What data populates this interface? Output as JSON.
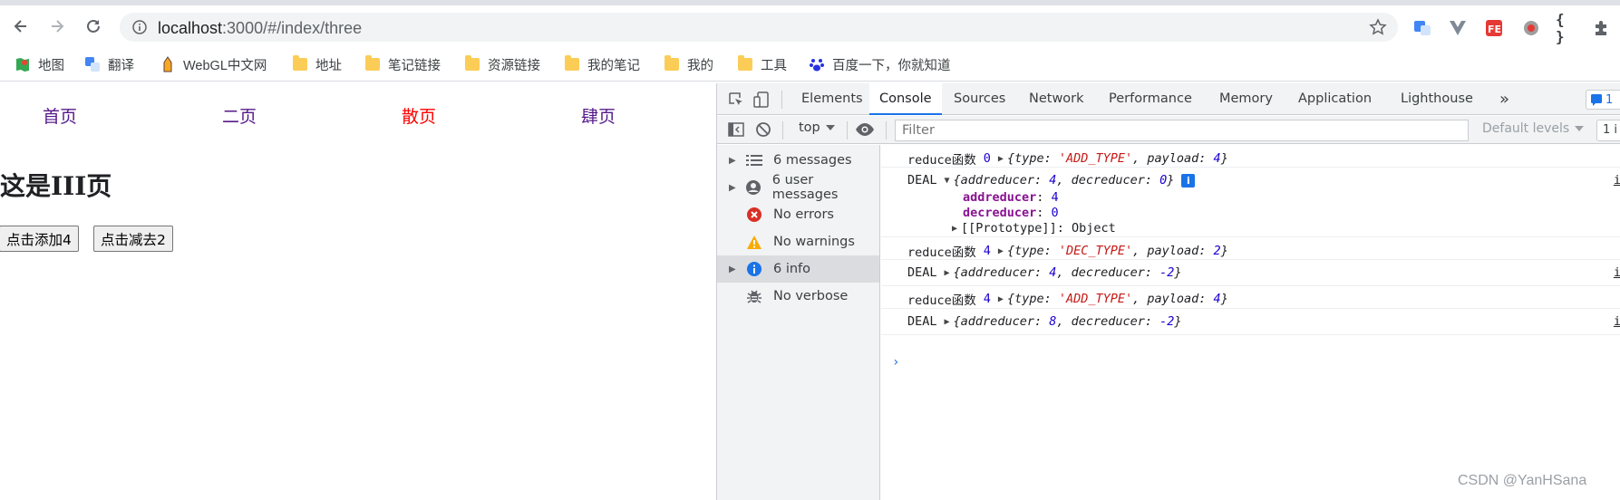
{
  "browser": {
    "url_host": "localhost",
    "url_rest": ":3000/#/index/three",
    "bookmarks": [
      {
        "label": "地图"
      },
      {
        "label": "翻译"
      },
      {
        "label": "WebGL中文网"
      },
      {
        "label": "地址"
      },
      {
        "label": "笔记链接"
      },
      {
        "label": "资源链接"
      },
      {
        "label": "我的笔记"
      },
      {
        "label": "我的"
      },
      {
        "label": "工具"
      },
      {
        "label": "百度一下，你就知道"
      }
    ],
    "ext_braces": "{ }"
  },
  "page": {
    "nav": [
      {
        "label": "首页",
        "color": "#551a8b"
      },
      {
        "label": "二页",
        "color": "#551a8b"
      },
      {
        "label": "散页",
        "color": "#ff0000"
      },
      {
        "label": "肆页",
        "color": "#551a8b"
      }
    ],
    "title": "这是III页",
    "add_button": "点击添加4",
    "sub_button": "点击减去2",
    "watermark": "CSDN @YanHSana"
  },
  "devtools": {
    "tabs": [
      "Elements",
      "Console",
      "Sources",
      "Network",
      "Performance",
      "Memory",
      "Application",
      "Lighthouse"
    ],
    "active_tab": "Console",
    "more_tabs": "»",
    "issues_count": "1",
    "context": "top",
    "filter_placeholder": "Filter",
    "levels": "Default levels",
    "hidden_count": "1 i",
    "sidebar": [
      {
        "label": "6 messages",
        "icon": "list-icon",
        "expandable": true
      },
      {
        "label": "6 user messages",
        "icon": "user-icon",
        "expandable": true
      },
      {
        "label": "No errors",
        "icon": "error-icon",
        "expandable": false
      },
      {
        "label": "No warnings",
        "icon": "warning-icon",
        "expandable": false
      },
      {
        "label": "6 info",
        "icon": "info-icon",
        "expandable": true,
        "selected": true
      },
      {
        "label": "No verbose",
        "icon": "bug-icon",
        "expandable": false
      }
    ],
    "console": {
      "row1": {
        "prefix": "reduce函数",
        "arg": "0",
        "obj_open": "{type: ",
        "type": "'ADD_TYPE'",
        "mid": ", payload: ",
        "payload": "4",
        "close": "}"
      },
      "row2": {
        "prefix": "DEAL",
        "obj_open": "{addreducer: ",
        "add": "4",
        "mid": ", decreducer: ",
        "dec": "0",
        "close": "}",
        "prop1_key": "addreducer",
        "prop1_val": "4",
        "prop2_key": "decreducer",
        "prop2_val": "0",
        "proto": "[[Prototype]]: Object",
        "badge": "i"
      },
      "row3": {
        "prefix": "reduce函数",
        "arg": "4",
        "obj_open": "{type: ",
        "type": "'DEC_TYPE'",
        "mid": ", payload: ",
        "payload": "2",
        "close": "}"
      },
      "row4": {
        "prefix": "DEAL",
        "obj_open": "{addreducer: ",
        "add": "4",
        "mid": ", decreducer: ",
        "dec": "-2",
        "close": "}"
      },
      "row5": {
        "prefix": "reduce函数",
        "arg": "4",
        "obj_open": "{type: ",
        "type": "'ADD_TYPE'",
        "mid": ", payload: ",
        "payload": "4",
        "close": "}"
      },
      "row6": {
        "prefix": "DEAL",
        "obj_open": "{addreducer: ",
        "add": "8",
        "mid": ", decreducer: ",
        "dec": "-2",
        "close": "}"
      },
      "src_link": "i",
      "prompt": "›"
    }
  }
}
